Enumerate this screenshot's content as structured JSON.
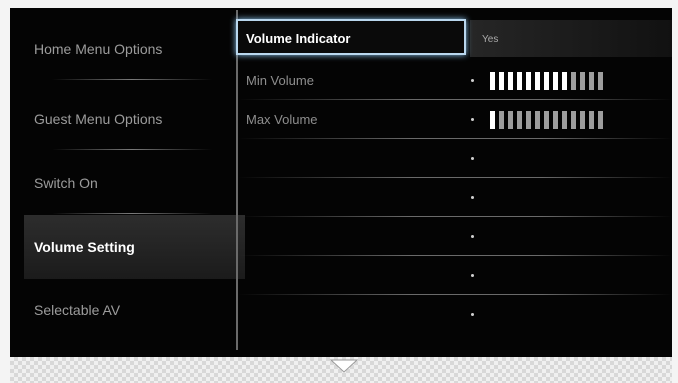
{
  "left_menu": {
    "items": [
      {
        "label": "Home Menu Options"
      },
      {
        "label": "Guest Menu Options"
      },
      {
        "label": "Switch On"
      },
      {
        "label": "Volume Setting",
        "selected": true
      },
      {
        "label": "Selectable AV"
      }
    ]
  },
  "settings": {
    "volume_indicator": {
      "label": "Volume Indicator",
      "value": "Yes"
    },
    "min_volume": {
      "label": "Min Volume",
      "level": 0.69
    },
    "max_volume": {
      "label": "Max Volume",
      "level": 0.08
    }
  },
  "colors": {
    "background": "#040404",
    "focus_border": "#b9d7ee",
    "text_dim": "#9c9c9c",
    "text_active": "#ffffff"
  },
  "icons": {
    "scroll_down": "chevron-down-icon"
  }
}
